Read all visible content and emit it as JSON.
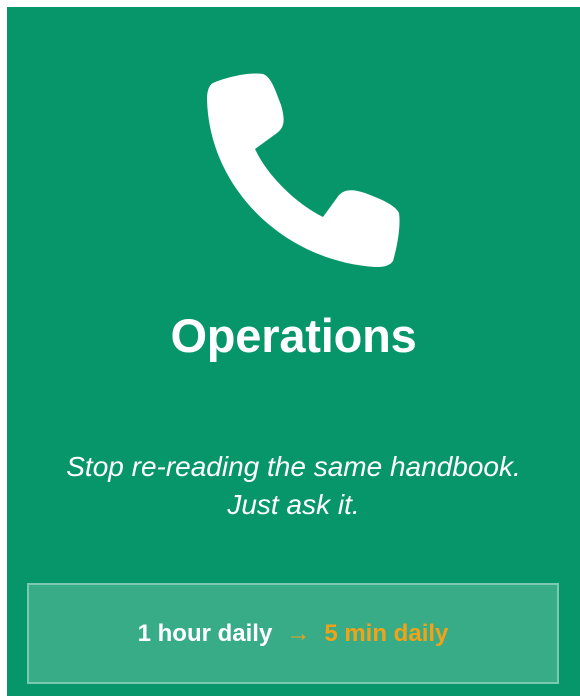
{
  "card": {
    "title": "Operations",
    "subtitle_line1": "Stop re-reading the same handbook.",
    "subtitle_line2": "Just ask it.",
    "icon": "phone-icon",
    "metric": {
      "before": "1 hour daily",
      "arrow": "→",
      "after": "5 min daily"
    }
  },
  "colors": {
    "card_background": "#07966a",
    "text": "#ffffff",
    "accent": "#f2a217"
  }
}
